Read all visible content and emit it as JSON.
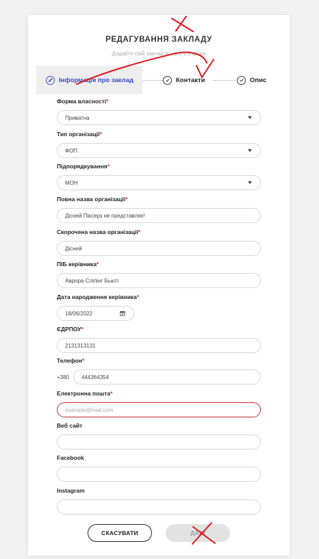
{
  "header": {
    "title": "РЕДАГУВАННЯ ЗАКЛАДУ",
    "subtitle": "Додайте свій заклад всього у 3 кроки"
  },
  "steps": [
    {
      "label": "Інформація про заклад",
      "icon": "pencil-icon",
      "active": true
    },
    {
      "label": "Контакти",
      "icon": "check-circle-icon",
      "active": false
    },
    {
      "label": "Опис",
      "icon": "check-circle-icon",
      "active": false
    }
  ],
  "form": {
    "ownership": {
      "label": "Форма власності",
      "value": "Приватна"
    },
    "org_type": {
      "label": "Тип організації",
      "value": "ФОП"
    },
    "subordination": {
      "label": "Підпорядкування",
      "value": "МОН"
    },
    "full_name": {
      "label": "Повна назва організації",
      "value": "Дісней Піксерз не представляє!"
    },
    "short_name": {
      "label": "Скорочена назва організації",
      "value": "Дісней"
    },
    "director": {
      "label": "ПІБ керівника",
      "value": "Аврора Сліпінг Бьюті"
    },
    "birth_date": {
      "label": "Дата народження керівника",
      "value": "18/06/2022"
    },
    "edrpou": {
      "label": "ЄДРПОУ",
      "value": "2131313131"
    },
    "phone": {
      "label": "Телефон",
      "prefix": "+380",
      "value": "444364354"
    },
    "email": {
      "label": "Електронна пошта",
      "placeholder": "example@mail.com"
    },
    "website": {
      "label": "Веб сайт",
      "value": ""
    },
    "facebook": {
      "label": "Facebook",
      "value": ""
    },
    "instagram": {
      "label": "Instagram",
      "value": ""
    }
  },
  "buttons": {
    "cancel": "СКАСУВАТИ",
    "next": "ДАЛІ"
  },
  "colors": {
    "accent": "#3b4bc8",
    "required": "#d0312d",
    "error_border": "#c0272d",
    "annotation": "#e0141b"
  }
}
